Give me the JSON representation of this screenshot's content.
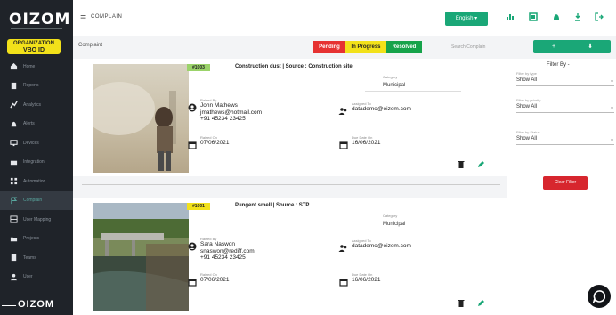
{
  "sidebar": {
    "logo": "OIZOM",
    "badge_label": "ORGANIZATION",
    "badge_value": "VBO ID",
    "items": [
      {
        "label": "Home",
        "icon": "home-icon"
      },
      {
        "label": "Reports",
        "icon": "reports-icon"
      },
      {
        "label": "Analytics",
        "icon": "analytics-icon"
      },
      {
        "label": "Alerts",
        "icon": "bell-icon"
      },
      {
        "label": "Devices",
        "icon": "monitor-icon"
      },
      {
        "label": "Integration",
        "icon": "keyboard-icon"
      },
      {
        "label": "Automation",
        "icon": "grid-icon"
      },
      {
        "label": "Complain",
        "icon": "flag-icon"
      },
      {
        "label": "User Mapping",
        "icon": "user-map-icon"
      },
      {
        "label": "Projects",
        "icon": "folder-icon"
      },
      {
        "label": "Teams",
        "icon": "team-icon"
      },
      {
        "label": "User",
        "icon": "user-icon"
      }
    ],
    "footer_logo": "OIZOM"
  },
  "topbar": {
    "breadcrumb": "COMPLAIN",
    "language_button": "English ▾"
  },
  "header": {
    "title": "Complaint",
    "status_pending": "Pending",
    "status_in_progress": "In Progress",
    "status_resolved": "Resolved",
    "search_placeholder": "Search Complain",
    "add_button": "+",
    "download_button": "⬇"
  },
  "complaints": [
    {
      "id": "#1003",
      "id_color": "#9bd36a",
      "title": "Construction dust | Source : Construction site",
      "category_label": "Category",
      "category": "Municipal",
      "raised_by_label": "Raised By",
      "raised_by_name": "John Mathews",
      "raised_by_email": "jmathews@hotmail.com",
      "raised_by_phone": "+91 45234 23425",
      "raised_on_label": "Raised On",
      "raised_on": "07/06/2021",
      "assigned_label": "Assigned To",
      "assigned_to": "datademo@oizom.com",
      "due_label": "Due Date On",
      "due_date": "16/06/2021"
    },
    {
      "id": "#1001",
      "id_color": "#f2e11a",
      "title": "Pungent smell | Source : STP",
      "category_label": "Category",
      "category": "Municipal",
      "raised_by_label": "Raised By",
      "raised_by_name": "Sara Naswon",
      "raised_by_email": "snaswon@rediff.com",
      "raised_by_phone": "+91 45234 23425",
      "raised_on_label": "Raised On",
      "raised_on": "07/06/2021",
      "assigned_label": "Assigned To",
      "assigned_to": "datademo@oizom.com",
      "due_label": "Due Date On",
      "due_date": "16/06/2021"
    }
  ],
  "filter": {
    "title": "Filter By -",
    "fields": [
      {
        "label": "Filter by type",
        "value": "Show All"
      },
      {
        "label": "Filter by priority",
        "value": "Show All"
      },
      {
        "label": "Filter by Status",
        "value": "Show All"
      }
    ],
    "clear_button": "Clear Filter"
  },
  "colors": {
    "accent": "#1aa777",
    "sidebar_bg": "#1f2329",
    "pending": "#e63232",
    "in_progress": "#f2e11a",
    "resolved": "#16a34a",
    "clear": "#d7262e"
  }
}
